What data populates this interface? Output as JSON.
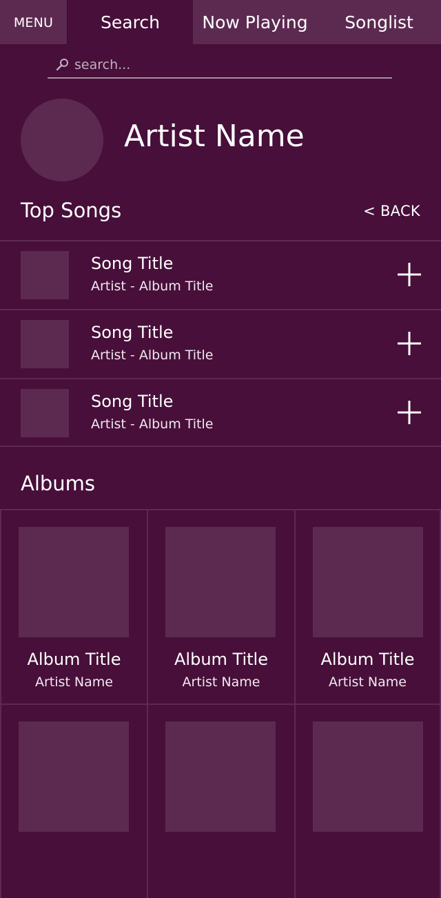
{
  "colors": {
    "background": "#470f3a",
    "tile": "#5c2a51",
    "divider": "#5e2a53",
    "text": "#ffffff"
  },
  "nav": {
    "menu_label": "MENU",
    "tabs": [
      {
        "label": "Search",
        "active": true
      },
      {
        "label": "Now Playing",
        "active": false
      },
      {
        "label": "Songlist",
        "active": false
      }
    ]
  },
  "search": {
    "placeholder": "search...",
    "value": "",
    "icon": "search-icon"
  },
  "artist": {
    "name": "Artist Name"
  },
  "top_songs": {
    "heading": "Top Songs",
    "back_label": "< BACK",
    "items": [
      {
        "title": "Song Title",
        "subtitle": "Artist - Album Title",
        "action_icon": "plus-icon"
      },
      {
        "title": "Song Title",
        "subtitle": "Artist - Album Title",
        "action_icon": "plus-icon"
      },
      {
        "title": "Song Title",
        "subtitle": "Artist - Album Title",
        "action_icon": "plus-icon"
      }
    ]
  },
  "albums": {
    "heading": "Albums",
    "items": [
      {
        "title": "Album Title",
        "artist": "Artist Name"
      },
      {
        "title": "Album Title",
        "artist": "Artist Name"
      },
      {
        "title": "Album Title",
        "artist": "Artist Name"
      },
      {
        "title": "",
        "artist": ""
      },
      {
        "title": "",
        "artist": ""
      },
      {
        "title": "",
        "artist": ""
      }
    ]
  }
}
